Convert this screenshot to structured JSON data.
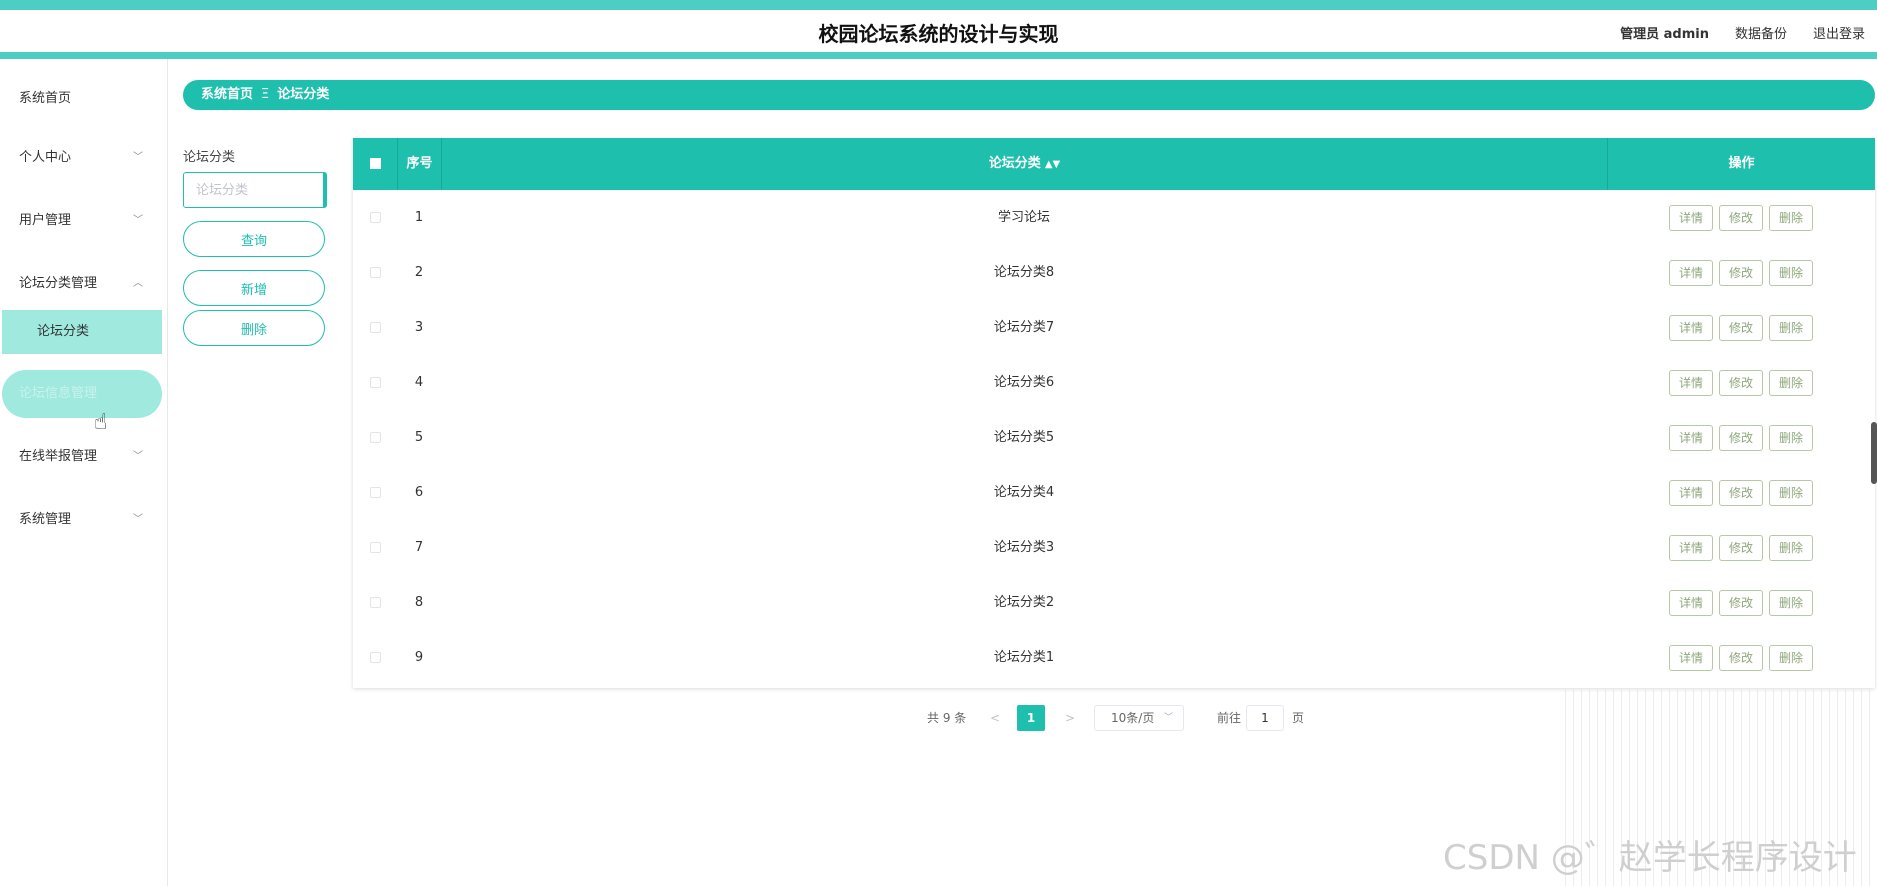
{
  "app": {
    "title": "校园论坛系统的设计与实现",
    "user_label": "管理员 admin",
    "backup_label": "数据备份",
    "logout_label": "退出登录"
  },
  "sidebar": {
    "items": [
      {
        "label": "系统首页"
      },
      {
        "label": "个人中心"
      },
      {
        "label": "用户管理"
      },
      {
        "label": "论坛分类管理"
      },
      {
        "label": "论坛分类"
      },
      {
        "label": "论坛信息管理"
      },
      {
        "label": "在线举报管理"
      },
      {
        "label": "系统管理"
      }
    ]
  },
  "breadcrumb": {
    "home": "系统首页",
    "separator": "Ξ",
    "current": "论坛分类"
  },
  "search": {
    "label": "论坛分类",
    "placeholder": "论坛分类",
    "query_label": "查询",
    "add_label": "新增",
    "delete_label": "删除"
  },
  "table": {
    "headers": {
      "index": "序号",
      "category": "论坛分类",
      "actions": "操作"
    },
    "rows": [
      {
        "index": "1",
        "category": "学习论坛"
      },
      {
        "index": "2",
        "category": "论坛分类8"
      },
      {
        "index": "3",
        "category": "论坛分类7"
      },
      {
        "index": "4",
        "category": "论坛分类6"
      },
      {
        "index": "5",
        "category": "论坛分类5"
      },
      {
        "index": "6",
        "category": "论坛分类4"
      },
      {
        "index": "7",
        "category": "论坛分类3"
      },
      {
        "index": "8",
        "category": "论坛分类2"
      },
      {
        "index": "9",
        "category": "论坛分类1"
      }
    ],
    "actions": {
      "detail": "详情",
      "edit": "修改",
      "delete": "删除"
    }
  },
  "pagination": {
    "total": "共 9 条",
    "prev": "<",
    "page": "1",
    "next": ">",
    "page_size": "10条/页",
    "goto": "前往",
    "jump_value": "1",
    "unit": "页"
  },
  "watermark": "CSDN @゛赵学长程序设计",
  "colors": {
    "accent": "#1ebfad",
    "header_line": "#4ecdc4",
    "menu_highlight": "#9fe9df"
  }
}
